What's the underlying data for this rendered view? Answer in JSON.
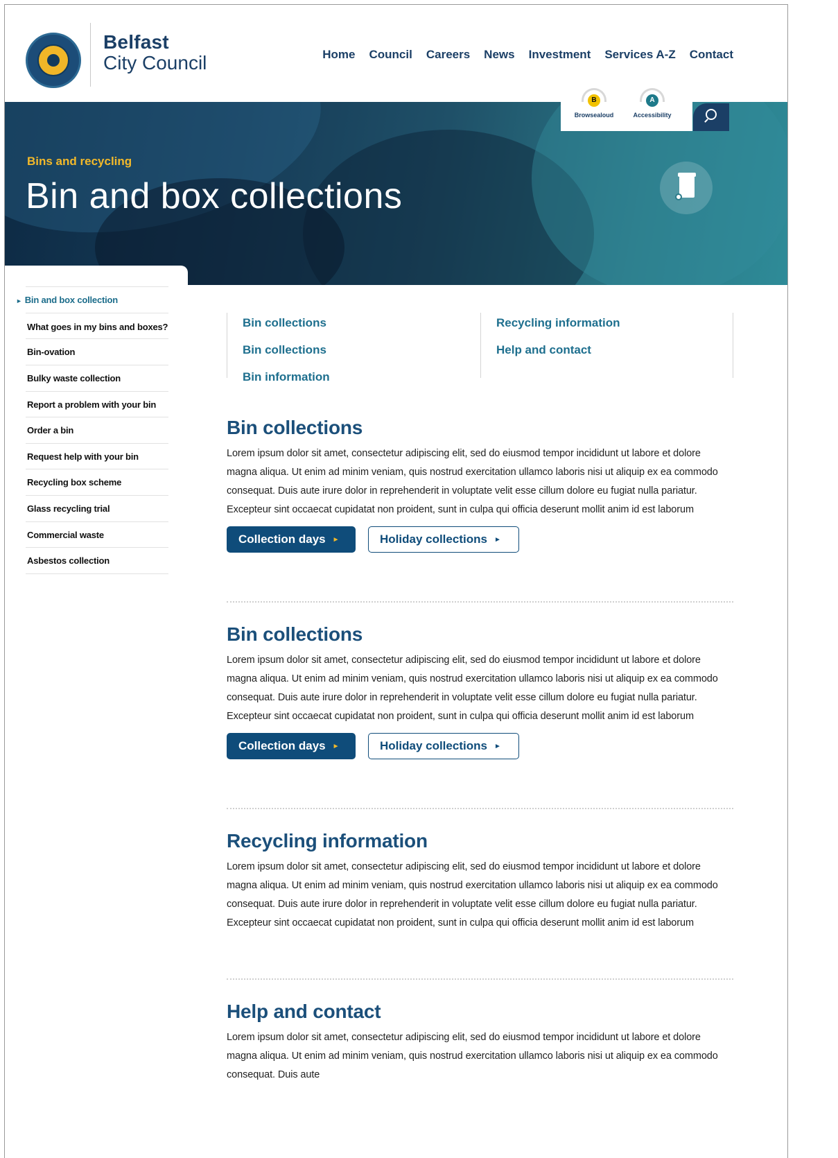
{
  "brand": {
    "line1": "Belfast",
    "line2": "City Council"
  },
  "nav": [
    "Home",
    "Council",
    "Careers",
    "News",
    "Investment",
    "Services A-Z",
    "Contact"
  ],
  "accessibility": {
    "browsealoud": {
      "badge": "B",
      "label": "Browsealoud"
    },
    "accessibility": {
      "badge": "A",
      "label": "Accessibility"
    }
  },
  "hero": {
    "kicker": "Bins and recycling",
    "title": "Bin and box collections"
  },
  "sidebar": {
    "items": [
      "Bin and box collection",
      "What goes in my bins and boxes?",
      "Bin-ovation",
      "Bulky waste collection",
      "Report a problem with your bin",
      "Order a bin",
      "Request help with your bin",
      "Recycling box scheme",
      "Glass recycling trial",
      "Commercial waste",
      "Asbestos collection"
    ]
  },
  "quicklinks": {
    "col1": [
      "Bin collections",
      "Bin collections",
      "Bin information"
    ],
    "col2": [
      "Recycling information",
      "Help and contact"
    ]
  },
  "sections": [
    {
      "title": "Bin collections",
      "body": "Lorem ipsum dolor sit amet, consectetur adipiscing elit, sed do eiusmod tempor incididunt ut labore et dolore magna aliqua. Ut enim ad minim veniam, quis nostrud exercitation ullamco laboris nisi ut aliquip ex ea commodo consequat. Duis aute irure dolor in reprehenderit in voluptate velit esse cillum dolore eu fugiat nulla pariatur. Excepteur sint occaecat cupidatat non proident, sunt in culpa qui officia deserunt mollit anim id est laborum",
      "btn1": "Collection days",
      "btn2": "Holiday collections"
    },
    {
      "title": "Bin collections",
      "body": "Lorem ipsum dolor sit amet, consectetur adipiscing elit, sed do eiusmod tempor incididunt ut labore et dolore magna aliqua. Ut enim ad minim veniam, quis nostrud exercitation ullamco laboris nisi ut aliquip ex ea commodo consequat. Duis aute irure dolor in reprehenderit in voluptate velit esse cillum dolore eu fugiat nulla pariatur. Excepteur sint occaecat cupidatat non proident, sunt in culpa qui officia deserunt mollit anim id est laborum",
      "btn1": "Collection days",
      "btn2": "Holiday collections"
    },
    {
      "title": "Recycling information",
      "body": "Lorem ipsum dolor sit amet, consectetur adipiscing elit, sed do eiusmod tempor incididunt ut labore et dolore magna aliqua. Ut enim ad minim veniam, quis nostrud exercitation ullamco laboris nisi ut aliquip ex ea commodo consequat. Duis aute irure dolor in reprehenderit in voluptate velit esse cillum dolore eu fugiat nulla pariatur. Excepteur sint occaecat cupidatat non proident, sunt in culpa qui officia deserunt mollit anim id est laborum"
    },
    {
      "title": "Help and contact",
      "body": "Lorem ipsum dolor sit amet, consectetur adipiscing elit, sed do eiusmod tempor incididunt ut labore et dolore magna aliqua. Ut enim ad minim veniam, quis nostrud exercitation ullamco laboris nisi ut aliquip ex ea commodo consequat. Duis aute"
    }
  ],
  "colors": {
    "navy": "#1b3f66",
    "teal": "#1e6f8e",
    "gold": "#f3b92a",
    "button": "#0f4c7a"
  }
}
